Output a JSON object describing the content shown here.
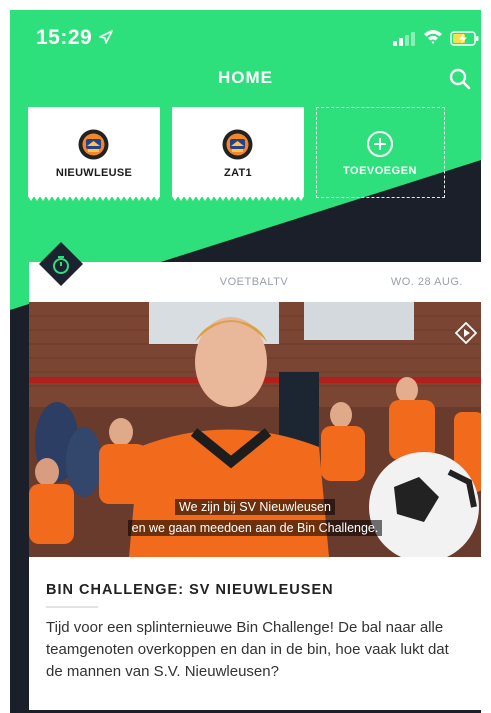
{
  "status_bar": {
    "time": "15:29"
  },
  "header": {
    "title": "HOME"
  },
  "teams": [
    {
      "name": "NIEUWLEUSE"
    },
    {
      "name": "ZAT1"
    }
  ],
  "add_team": {
    "label": "TOEVOEGEN"
  },
  "article": {
    "source": "VOETBALTV",
    "date": "WO. 28 AUG.",
    "subtitle_line1": "We zijn bij SV Nieuwleusen",
    "subtitle_line2": "en we gaan meedoen aan de Bin Challenge.",
    "title": "BIN CHALLENGE: SV NIEUWLEUSEN",
    "body": "Tijd voor een splinternieuwe Bin Challenge! De bal naar alle teamgenoten overkoppen en dan in de bin, hoe vaak lukt dat de mannen van S.V. Nieuwleusen?"
  },
  "colors": {
    "brand_green": "#2ee07c",
    "dark_bg": "#1b1f2a",
    "jersey_orange": "#f26a1b"
  },
  "icons": [
    "location-arrow-icon",
    "signal-icon",
    "wifi-icon",
    "battery-charging-icon",
    "search-icon",
    "club-logo-icon",
    "add-circle-icon",
    "stopwatch-badge-icon",
    "video-play-icon"
  ]
}
